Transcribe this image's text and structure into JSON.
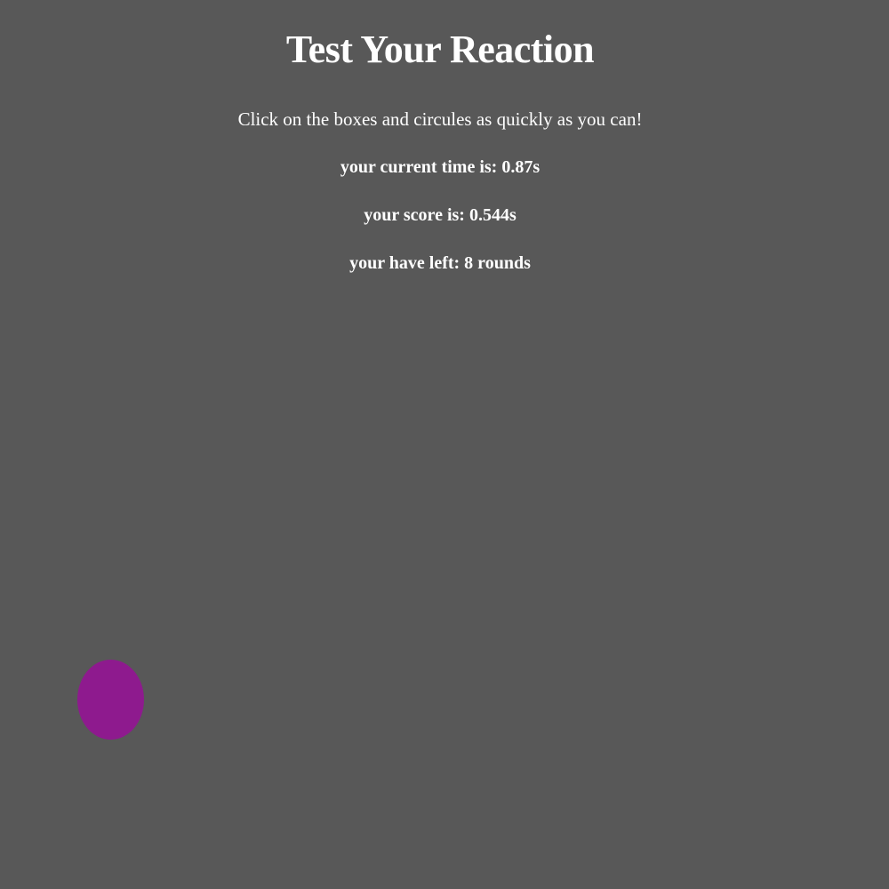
{
  "game": {
    "title": "Test Your Reaction",
    "instructions": "Click on the boxes and circules as quickly as you can!",
    "current_time_text": "your current time is: 0.87s",
    "score_text": "your score is: 0.544s",
    "rounds_text": "your have left: 8 rounds"
  },
  "target": {
    "shape": "circle",
    "color": "#8e1a8e"
  },
  "colors": {
    "background": "#585858",
    "text": "#ffffff"
  }
}
